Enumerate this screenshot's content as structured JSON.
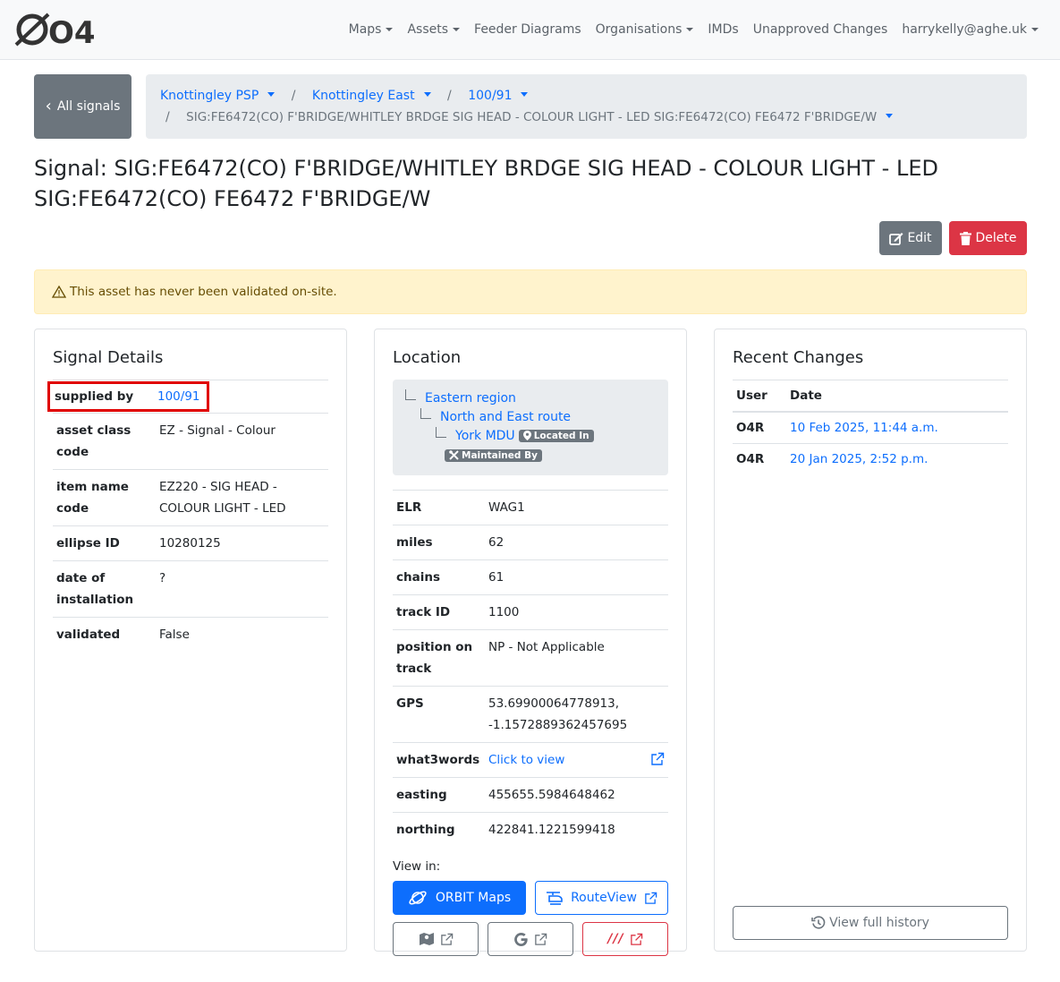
{
  "nav": {
    "logo_text": "O4R",
    "items": [
      {
        "label": "Maps",
        "dropdown": true
      },
      {
        "label": "Assets",
        "dropdown": true
      },
      {
        "label": "Feeder Diagrams",
        "dropdown": false
      },
      {
        "label": "Organisations",
        "dropdown": true
      },
      {
        "label": "IMDs",
        "dropdown": false
      },
      {
        "label": "Unapproved Changes",
        "dropdown": false
      },
      {
        "label": "harrykelly@aghe.uk",
        "dropdown": true
      }
    ]
  },
  "back_button": {
    "label": "All signals"
  },
  "breadcrumb": {
    "items": [
      "Knottingley PSP",
      "Knottingley East",
      "100/91"
    ],
    "active": "SIG:FE6472(CO) F'BRIDGE/WHITLEY BRDGE SIG HEAD - COLOUR LIGHT - LED SIG:FE6472(CO) FE6472 F'BRIDGE/W"
  },
  "page": {
    "title_line1": "Signal: SIG:FE6472(CO) F'BRIDGE/WHITLEY BRDGE SIG HEAD - COLOUR LIGHT - LED",
    "title_line2": "SIG:FE6472(CO) FE6472 F'BRIDGE/W"
  },
  "actions": {
    "edit_label": "Edit",
    "delete_label": "Delete"
  },
  "alert": {
    "text": "This asset has never been validated on-site."
  },
  "signal_details": {
    "title": "Signal Details",
    "rows": [
      {
        "key": "supplied by",
        "value": "100/91",
        "link": true
      },
      {
        "key": "asset class code",
        "value": "EZ - Signal - Colour"
      },
      {
        "key": "item name code",
        "value": "EZ220 - SIG HEAD - COLOUR LIGHT - LED"
      },
      {
        "key": "ellipse ID",
        "value": "10280125"
      },
      {
        "key": "date of installation",
        "value": "?"
      },
      {
        "key": "validated",
        "value": "False"
      }
    ]
  },
  "location": {
    "title": "Location",
    "tree": {
      "region": "Eastern region",
      "route": "North and East route",
      "mdu": "York MDU",
      "located_in_badge": "Located In",
      "maintained_by_badge": "Maintained By"
    },
    "rows": [
      {
        "key": "ELR",
        "value": "WAG1"
      },
      {
        "key": "miles",
        "value": "62"
      },
      {
        "key": "chains",
        "value": "61"
      },
      {
        "key": "track ID",
        "value": "1100"
      },
      {
        "key": "position on track",
        "value": "NP - Not Applicable"
      },
      {
        "key": "GPS",
        "value": "53.69900064778913, -1.1572889362457695"
      },
      {
        "key": "what3words",
        "value": "Click to view",
        "link": true
      },
      {
        "key": "easting",
        "value": "455655.5984648462"
      },
      {
        "key": "northing",
        "value": "422841.1221599418"
      }
    ],
    "view_in_label": "View in:",
    "orbit_maps_label": "ORBIT Maps",
    "routeview_label": "RouteView",
    "w3w_glyph": "///"
  },
  "recent_changes": {
    "title": "Recent Changes",
    "headers": {
      "user": "User",
      "date": "Date"
    },
    "rows": [
      {
        "user": "O4R",
        "date": "10 Feb 2025, 11:44 a.m."
      },
      {
        "user": "O4R",
        "date": "20 Jan 2025, 2:52 p.m."
      }
    ],
    "history_label": "View full history"
  },
  "colors": {
    "primary": "#0d6efd",
    "secondary": "#6c757d",
    "danger": "#dc3545",
    "warning_bg": "#fff3cd",
    "highlight": "#e00000"
  }
}
